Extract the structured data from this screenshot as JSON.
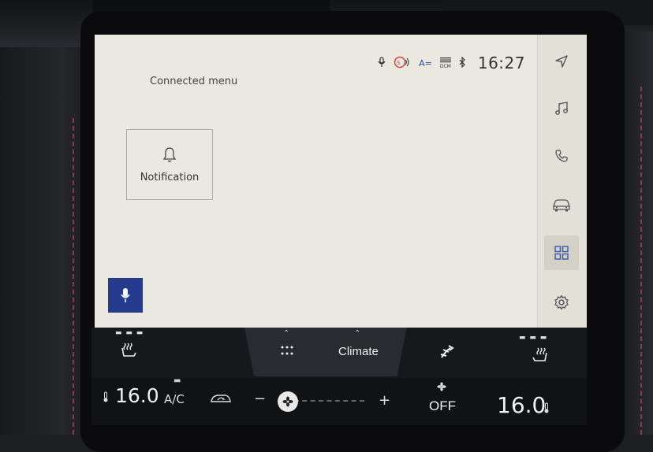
{
  "header": {
    "title": "Connected menu",
    "clock": "16:27"
  },
  "status_icons": [
    "voice-off-icon",
    "ecall-icon",
    "language-icon",
    "dcm-icon",
    "bluetooth-icon"
  ],
  "status_labels": {
    "dcm": "DCM",
    "language": "A="
  },
  "tiles": [
    {
      "label": "Notification",
      "icon": "bell-icon"
    }
  ],
  "rail": {
    "items": [
      "navigation-icon",
      "music-icon",
      "phone-icon",
      "car-icon",
      "apps-icon",
      "settings-icon"
    ],
    "active": "apps-icon"
  },
  "lowerbar": {
    "climate_label": "Climate"
  },
  "climate": {
    "left_temp": "16.0",
    "right_temp": "16.0",
    "ac_label": "A/C",
    "fan_minus": "−",
    "fan_plus": "+",
    "fan_status": "OFF",
    "fan_level": 0
  },
  "colors": {
    "screen_bg": "#ebe8e1",
    "accent": "#273b8e",
    "bar_bg": "#17181b"
  }
}
